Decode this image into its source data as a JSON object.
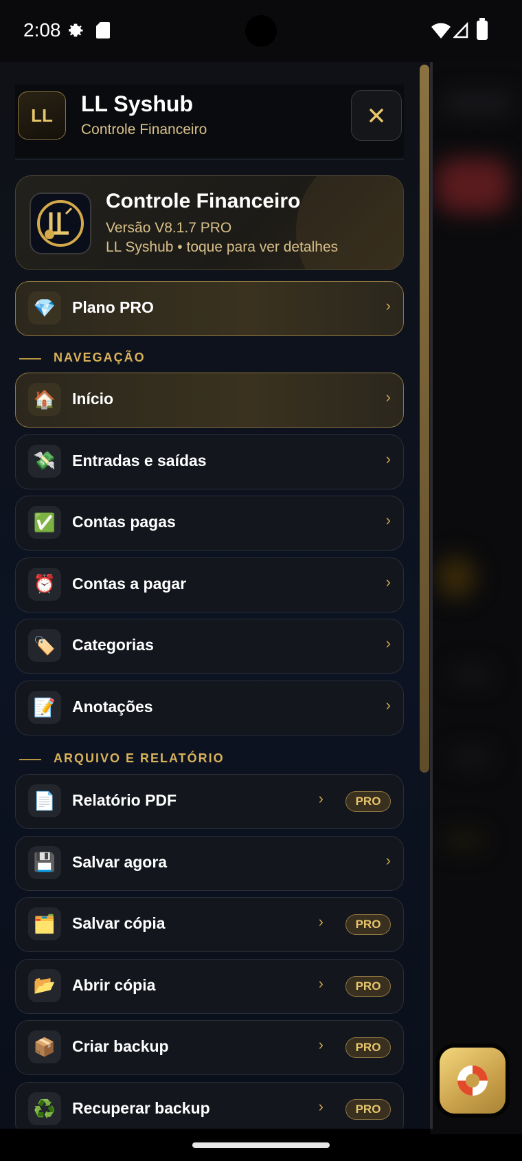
{
  "status_bar": {
    "time": "2:08"
  },
  "drawer": {
    "header": {
      "logo_text": "LL",
      "name": "LL Syshub",
      "subtitle": "Controle Financeiro"
    },
    "app_card": {
      "title": "Controle Financeiro",
      "version": "Versão V8.1.7 PRO",
      "meta": "LL Syshub • toque para ver detalhes"
    },
    "plan": {
      "label": "Plano PRO",
      "icon": "gem-icon"
    },
    "sections": {
      "navigation": "NAVEGAÇÃO",
      "file_report": "ARQUIVO E RELATÓRIO"
    },
    "nav_items": [
      {
        "label": "Início",
        "emoji": "🏠",
        "icon": "house-icon"
      },
      {
        "label": "Entradas e saídas",
        "emoji": "💸",
        "icon": "money-wings-icon"
      },
      {
        "label": "Contas pagas",
        "emoji": "✅",
        "icon": "check-mark-icon"
      },
      {
        "label": "Contas a pagar",
        "emoji": "⏰",
        "icon": "alarm-clock-icon"
      },
      {
        "label": "Categorias",
        "emoji": "🏷️",
        "icon": "label-tag-icon"
      },
      {
        "label": "Anotações",
        "emoji": "📝",
        "icon": "memo-icon"
      }
    ],
    "file_items": [
      {
        "label": "Relatório PDF",
        "emoji": "📄",
        "icon": "document-icon",
        "badge": "PRO"
      },
      {
        "label": "Salvar agora",
        "emoji": "💾",
        "icon": "floppy-disk-icon"
      },
      {
        "label": "Salvar cópia",
        "emoji": "🗂️",
        "icon": "card-index-icon",
        "badge": "PRO"
      },
      {
        "label": "Abrir cópia",
        "emoji": "📂",
        "icon": "open-folder-icon",
        "badge": "PRO"
      },
      {
        "label": "Criar backup",
        "emoji": "📦",
        "icon": "package-icon",
        "badge": "PRO"
      },
      {
        "label": "Recuperar backup",
        "emoji": "♻️",
        "icon": "recycle-icon",
        "badge": "PRO"
      }
    ],
    "chevron": "›"
  },
  "colors": {
    "accent_gold": "#d9b25a",
    "drawer_bg": "#0c1322",
    "card_border": "#2a2e38"
  }
}
